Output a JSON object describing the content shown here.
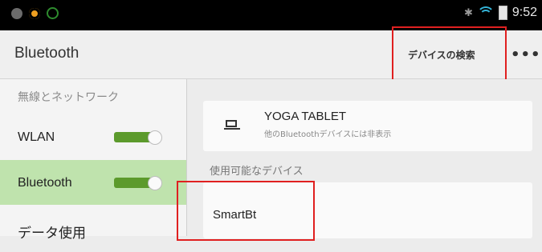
{
  "status_bar": {
    "time": "9:52",
    "bluetooth_glyph": "✱"
  },
  "action_bar": {
    "title": "Bluetooth",
    "search_devices": "デバイスの検索",
    "overflow": "•••"
  },
  "sidebar": {
    "header": "無線とネットワーク",
    "items": [
      {
        "label": "WLAN",
        "toggle_on": true
      },
      {
        "label": "Bluetooth",
        "toggle_on": true,
        "selected": true
      },
      {
        "label": "データ使用"
      }
    ]
  },
  "main": {
    "this_device": {
      "name": "YOGA TABLET",
      "subtitle": "他のBluetoothデバイスには非表示",
      "icon": "laptop-icon"
    },
    "available_section_title": "使用可能なデバイス",
    "available_devices": [
      {
        "name": "SmartBt"
      }
    ]
  },
  "colors": {
    "selected_bg": "#bfe3ad",
    "toggle_on": "#5c9a2c",
    "highlight": "#e02020"
  }
}
